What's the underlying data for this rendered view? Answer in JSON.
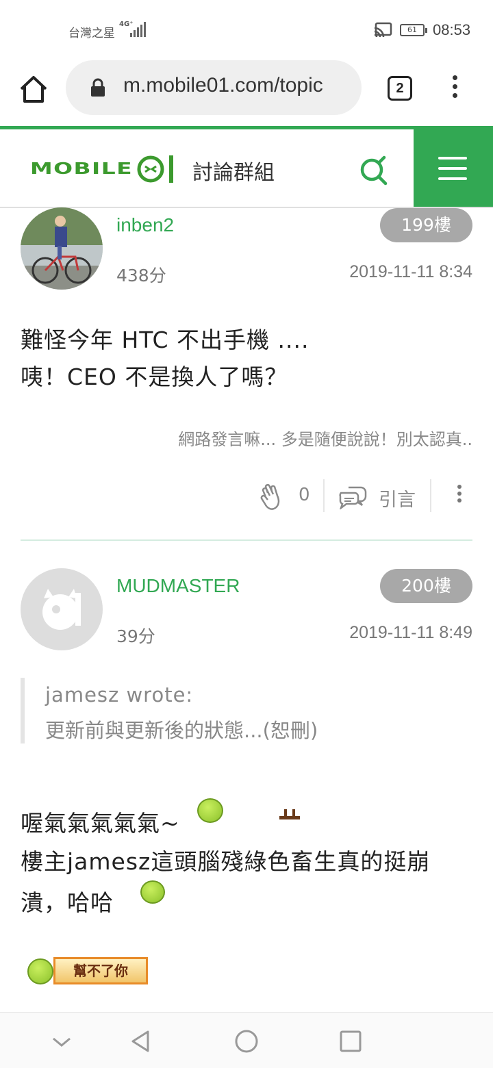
{
  "status_bar": {
    "carrier": "台灣之星",
    "network": "4G⁺",
    "battery": "61",
    "time": "08:53"
  },
  "browser": {
    "url": "m.mobile01.com/topic",
    "tab_count": "2"
  },
  "site": {
    "logo_text": "MOBILE01",
    "section_title": "討論群組"
  },
  "posts": [
    {
      "username": "inben2",
      "floor": "199樓",
      "score": "438分",
      "date": "2019-11-11 8:34",
      "lines": [
        "難怪今年 HTC 不出手機 ....",
        "咦！CEO 不是換人了嗎？"
      ],
      "signature": "網路發言嘛... 多是隨便說說！別太認真..",
      "likes": "0",
      "quote_label": "引言"
    },
    {
      "username": "MUDMASTER",
      "floor": "200樓",
      "score": "39分",
      "date": "2019-11-11 8:49",
      "quote_author": "jamesz wrote:",
      "quote_text": "更新前與更新後的狀態...(恕刪)",
      "lines": [
        "喔氣氣氣氣氣~",
        "樓主jamesz這頭腦殘綠色畜生真的挺崩",
        "潰，哈哈"
      ],
      "emoticon_text": "幫不了你"
    }
  ],
  "colors": {
    "brand_green": "#32a853",
    "floor_badge": "#a8a8a8"
  }
}
